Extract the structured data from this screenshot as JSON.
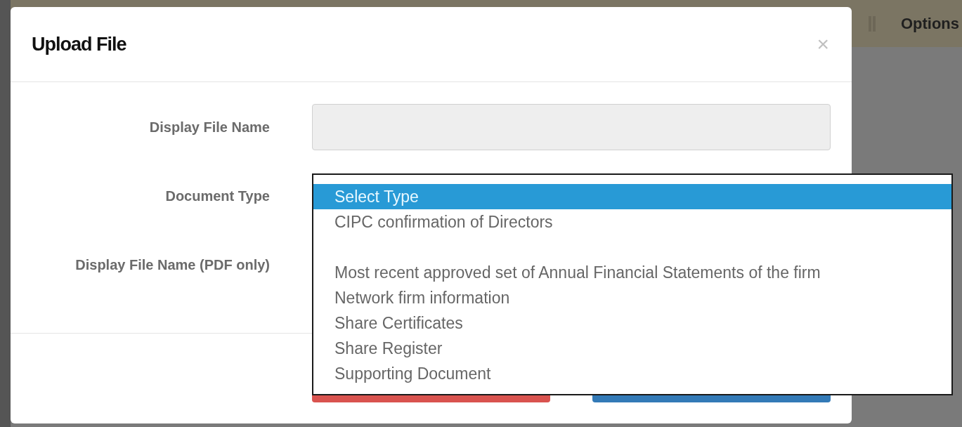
{
  "background": {
    "top_bar": {
      "label": "Options"
    }
  },
  "modal": {
    "title": "Upload File",
    "close": "×",
    "fields": [
      {
        "label": "Display File Name",
        "kind": "text"
      },
      {
        "label": "Document Type",
        "kind": "select"
      },
      {
        "label": "Display File Name (PDF only)",
        "kind": "file"
      }
    ],
    "buttons": [
      {
        "kind": "danger"
      },
      {
        "kind": "primary"
      }
    ]
  },
  "dropdown": {
    "options": [
      {
        "kind": "option",
        "label": "Select Type",
        "selected": true
      },
      {
        "kind": "option",
        "label": "CIPC confirmation of Directors",
        "selected": false
      },
      {
        "kind": "blank"
      },
      {
        "kind": "option",
        "label": "Most recent approved set of Annual Financial Statements of the firm",
        "selected": false
      },
      {
        "kind": "option",
        "label": "Network firm information",
        "selected": false
      },
      {
        "kind": "option",
        "label": "Share Certificates",
        "selected": false
      },
      {
        "kind": "option",
        "label": "Share Register",
        "selected": false
      },
      {
        "kind": "option",
        "label": "Supporting Document",
        "selected": false
      }
    ]
  }
}
